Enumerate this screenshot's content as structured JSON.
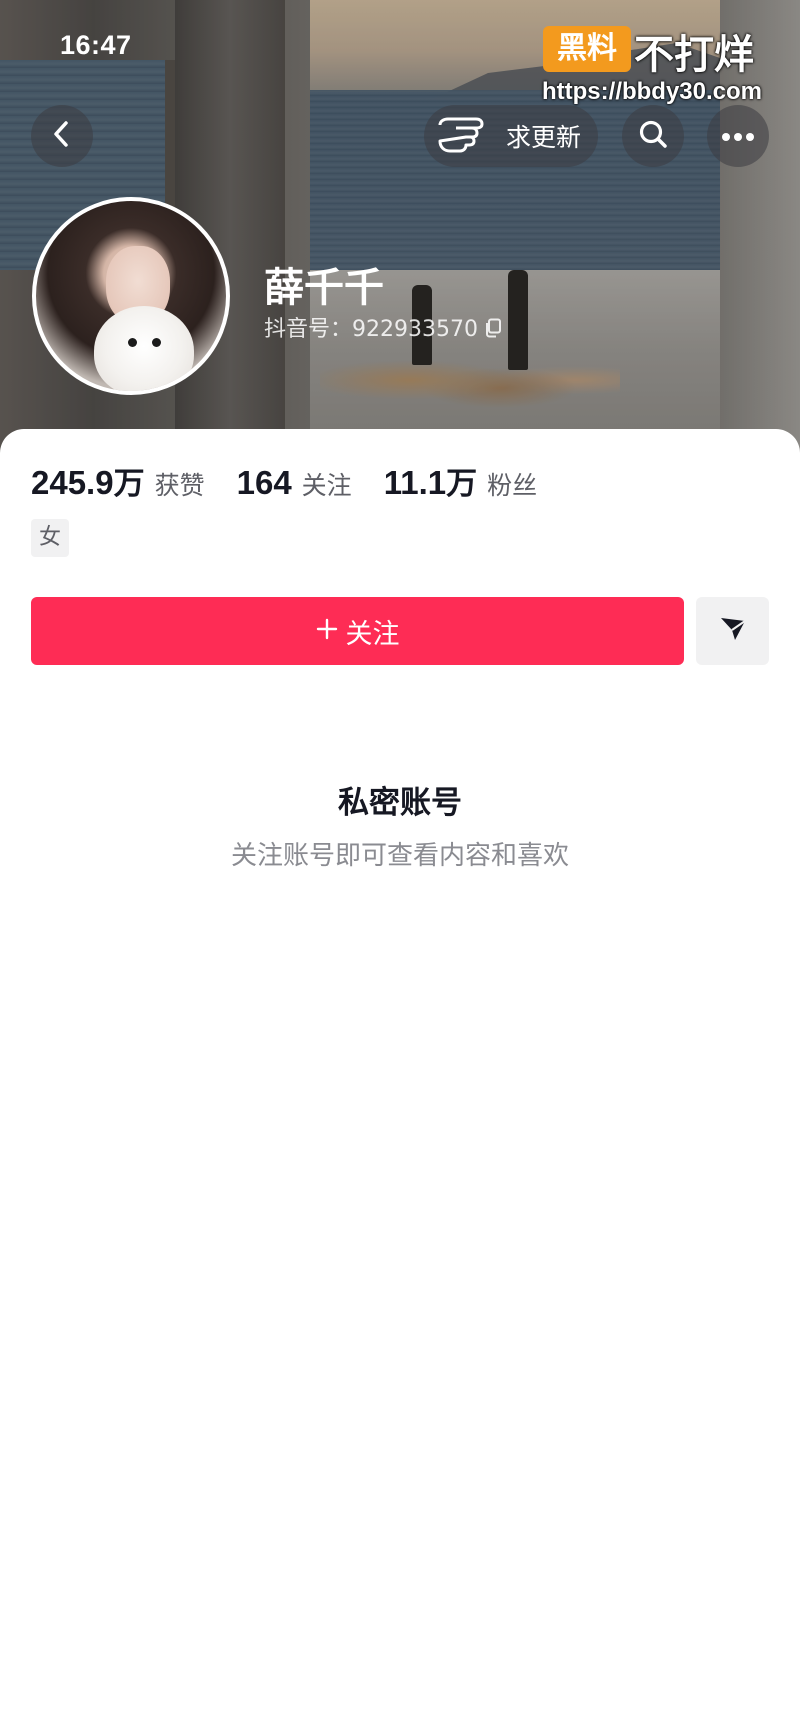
{
  "status_bar": {
    "time": "16:47"
  },
  "watermark": {
    "badge": "黑料",
    "text": "不打烊",
    "url": "https://bbdy30.com"
  },
  "header": {
    "request_update_label": "求更新",
    "icons": {
      "back": "chevron-left-icon",
      "pointing_hand": "pointing-hand-icon",
      "search": "search-icon",
      "more": "more-horizontal-icon"
    }
  },
  "profile": {
    "name": "薛千千",
    "douyin_id": "抖音号：922933570",
    "stats": [
      {
        "value_num": "245.9",
        "value_unit": "万",
        "label": "获赞"
      },
      {
        "value_num": "164",
        "value_unit": "",
        "label": "关注"
      },
      {
        "value_num": "11.1",
        "value_unit": "万",
        "label": "粉丝"
      }
    ],
    "gender_tag": "女"
  },
  "actions": {
    "follow_label": "关注",
    "follow_icon": "plus-icon",
    "share_icon": "send-icon"
  },
  "private": {
    "title": "私密账号",
    "subtitle": "关注账号即可查看内容和喜欢"
  },
  "colors": {
    "follow_button": "#fe2c55",
    "watermark_badge": "#f39a1e",
    "secondary_text": "#8a8b91"
  }
}
